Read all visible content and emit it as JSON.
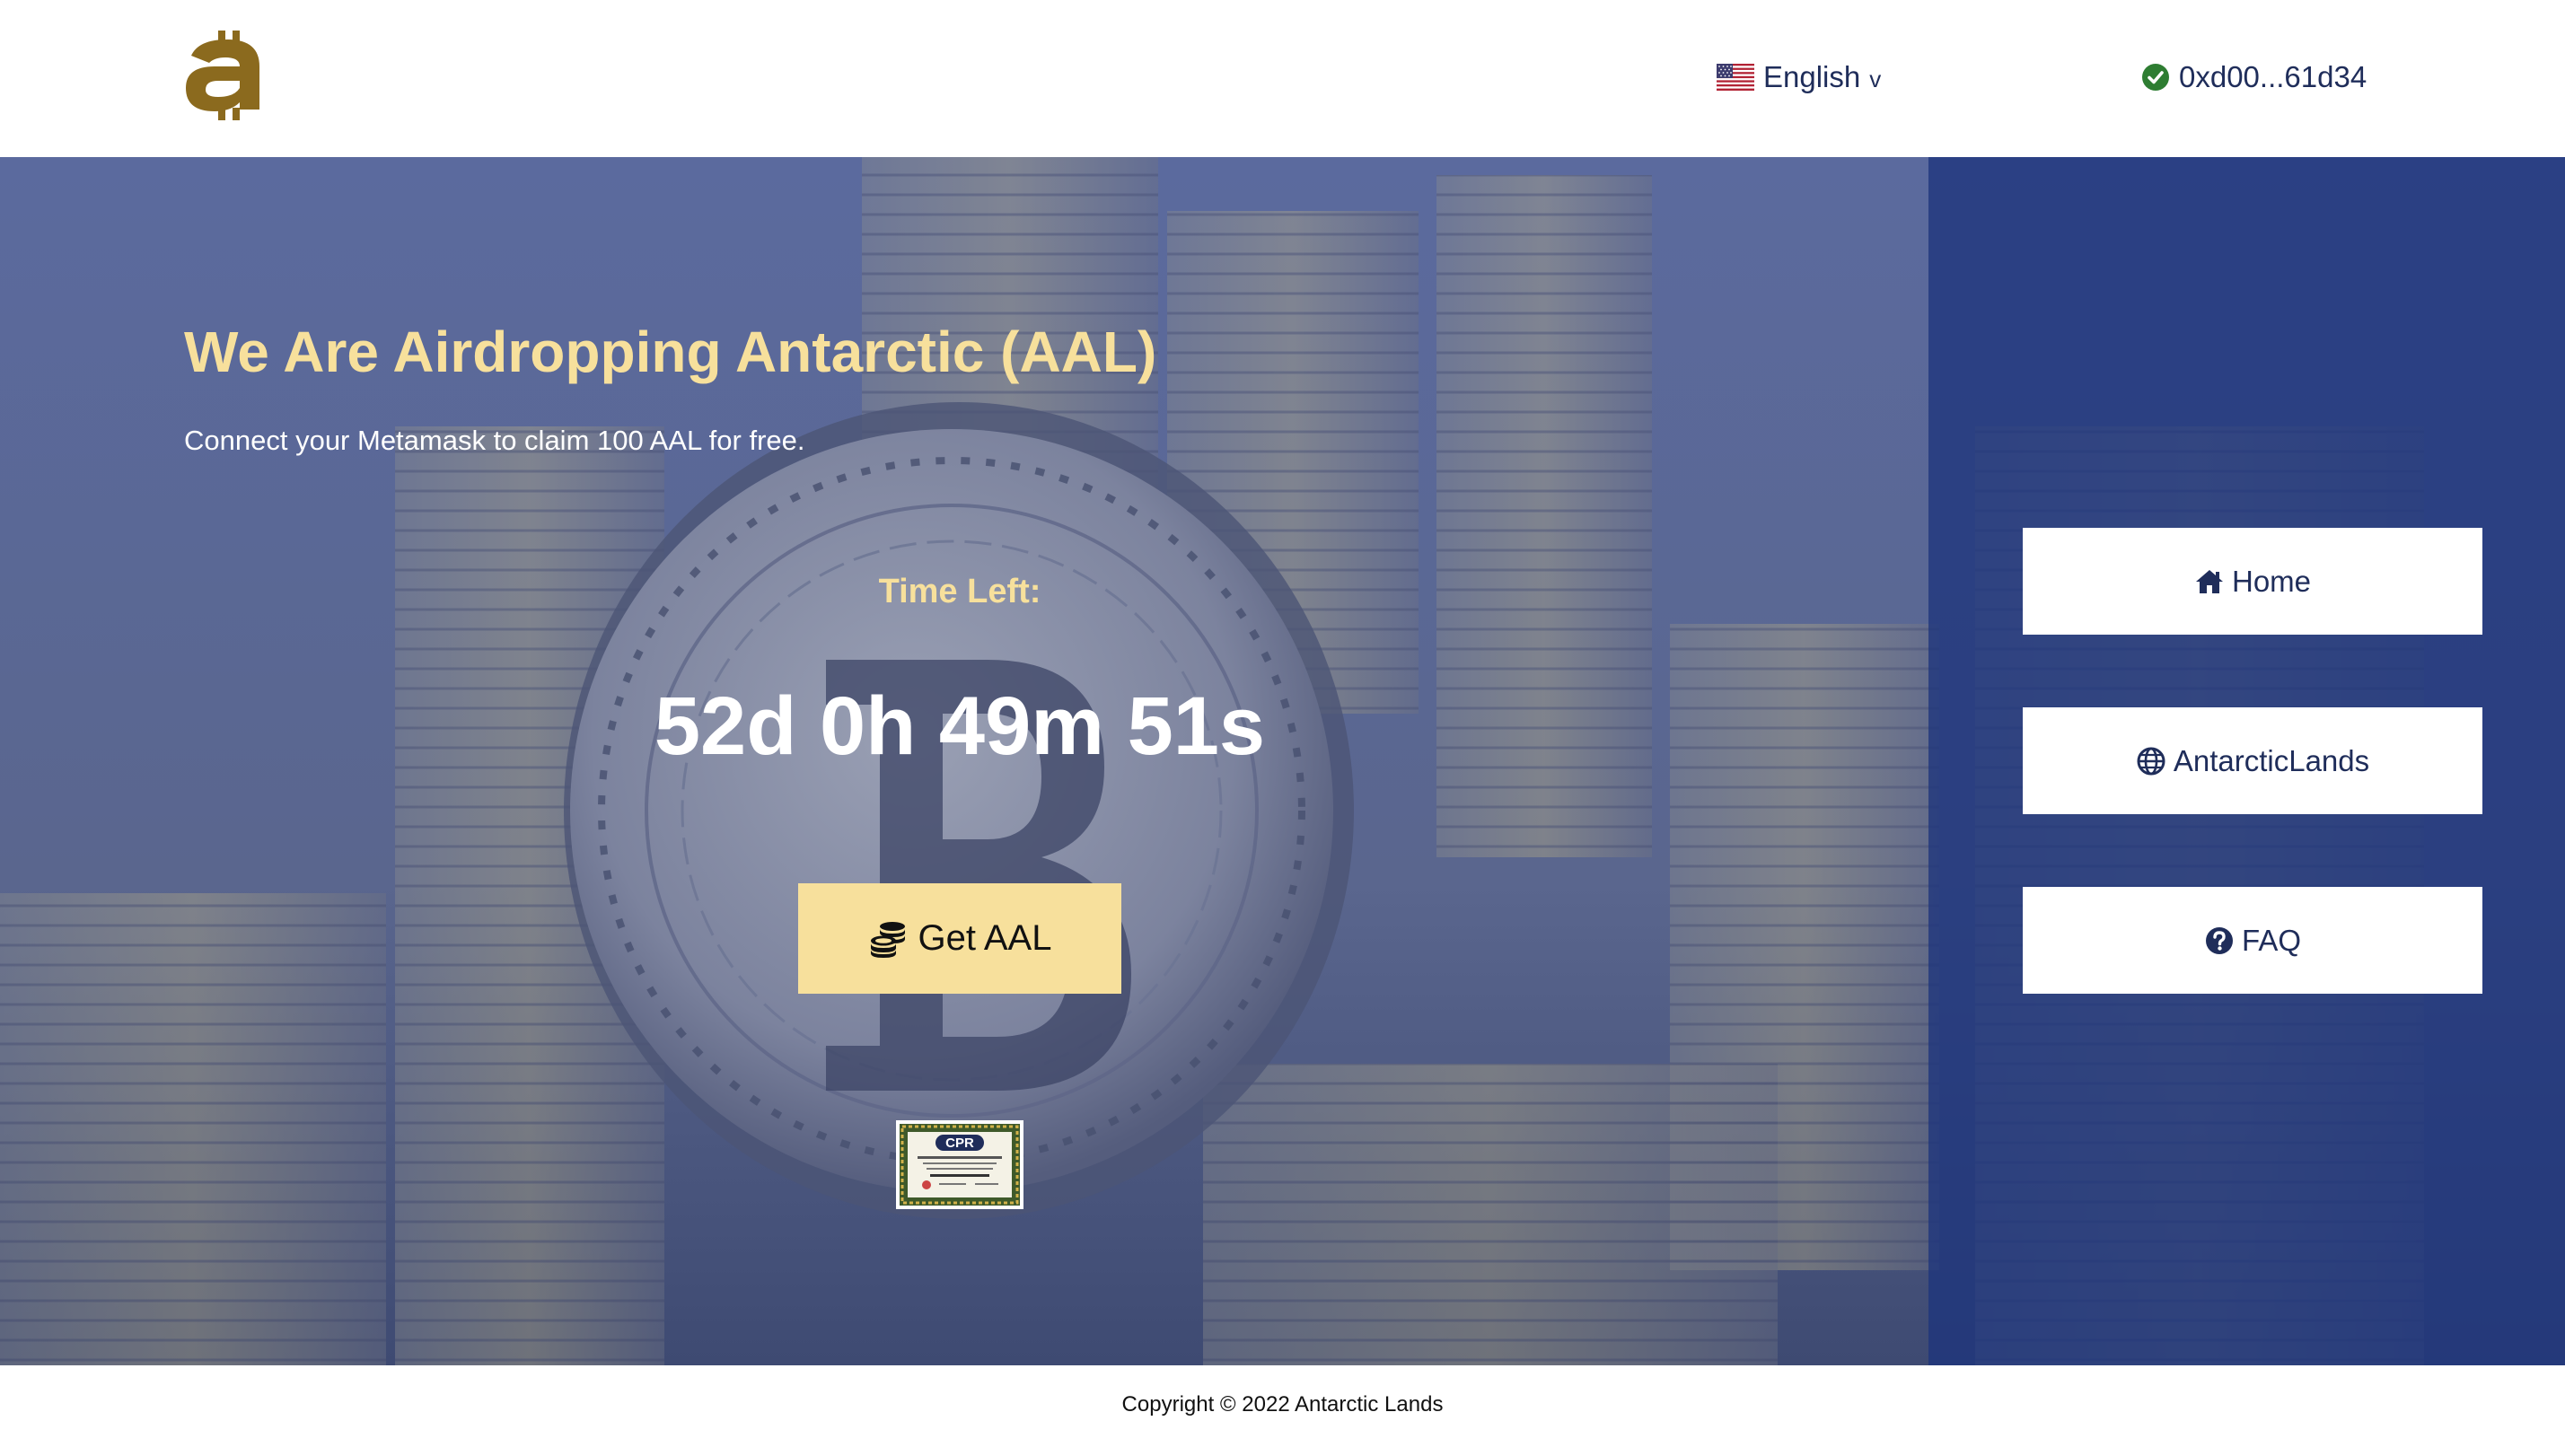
{
  "header": {
    "logo_icon": "bitcoin-a-logo",
    "language": {
      "flag_icon": "us-flag-icon",
      "label": "English",
      "chevron": "v"
    },
    "wallet": {
      "status_icon": "check-circle-icon",
      "address": "0xd00...61d34"
    }
  },
  "hero": {
    "headline": "We Are Airdropping Antarctic (AAL)",
    "subline": "Connect your Metamask to claim 100 AAL for free.",
    "time_left_label": "Time Left:",
    "countdown": "52d 0h 49m 51s",
    "claim_button": {
      "icon": "coins-icon",
      "label": "Get AAL"
    },
    "certificate": {
      "badge_text": "CPR"
    }
  },
  "side_nav": [
    {
      "icon": "home-icon",
      "label": "Home"
    },
    {
      "icon": "globe-icon",
      "label": "AntarcticLands"
    },
    {
      "icon": "question-circle-icon",
      "label": "FAQ"
    }
  ],
  "footer": {
    "copyright": "Copyright © 2022 Antarctic Lands"
  },
  "colors": {
    "accent_gold": "#f7e09c",
    "logo_gold": "#8b6a1e",
    "navy_text": "#1f2d5a",
    "hero_blue": "#505f94",
    "panel_blue": "#1e347c",
    "success_green": "#2e7d32"
  }
}
